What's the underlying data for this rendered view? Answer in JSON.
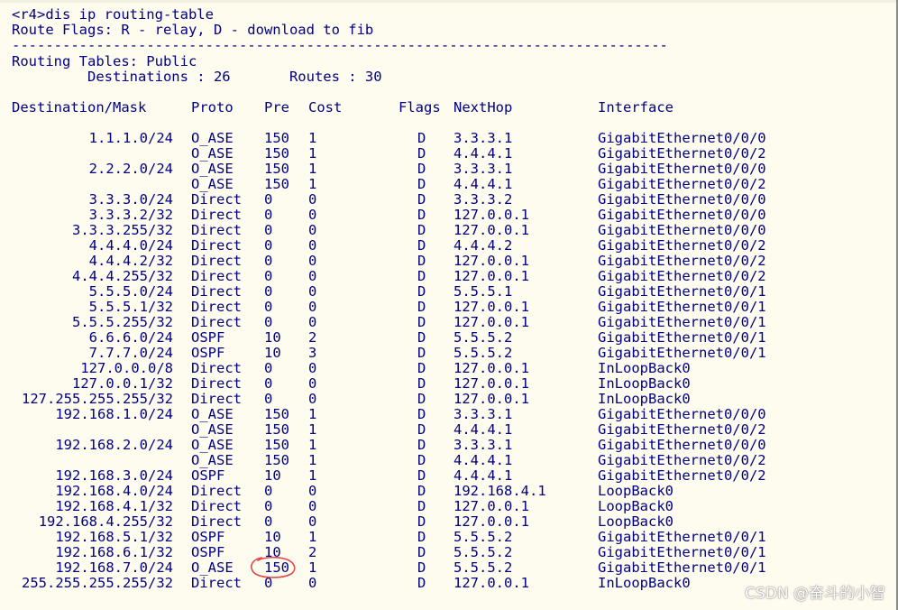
{
  "command_line": "<r4>dis ip routing-table",
  "flags_legend": "Route Flags: R - relay, D - download to fib",
  "separator": "------------------------------------------------------------------------------",
  "table_name": "Routing Tables: Public",
  "summary": "         Destinations : 26       Routes : 30",
  "headers": {
    "destination": "Destination/Mask",
    "proto": "Proto",
    "pre": "Pre",
    "cost": "Cost",
    "flags": "Flags",
    "nexthop": "NextHop",
    "interface": "Interface"
  },
  "routes": [
    {
      "dest": "1.1.1.0/24",
      "proto": "O_ASE",
      "pre": "150",
      "cost": "1",
      "flags": "D",
      "nexthop": "3.3.3.1",
      "iface": "GigabitEthernet0/0/0"
    },
    {
      "dest": "",
      "proto": "O_ASE",
      "pre": "150",
      "cost": "1",
      "flags": "D",
      "nexthop": "4.4.4.1",
      "iface": "GigabitEthernet0/0/2"
    },
    {
      "dest": "2.2.2.0/24",
      "proto": "O_ASE",
      "pre": "150",
      "cost": "1",
      "flags": "D",
      "nexthop": "3.3.3.1",
      "iface": "GigabitEthernet0/0/0"
    },
    {
      "dest": "",
      "proto": "O_ASE",
      "pre": "150",
      "cost": "1",
      "flags": "D",
      "nexthop": "4.4.4.1",
      "iface": "GigabitEthernet0/0/2"
    },
    {
      "dest": "3.3.3.0/24",
      "proto": "Direct",
      "pre": "0",
      "cost": "0",
      "flags": "D",
      "nexthop": "3.3.3.2",
      "iface": "GigabitEthernet0/0/0"
    },
    {
      "dest": "3.3.3.2/32",
      "proto": "Direct",
      "pre": "0",
      "cost": "0",
      "flags": "D",
      "nexthop": "127.0.0.1",
      "iface": "GigabitEthernet0/0/0"
    },
    {
      "dest": "3.3.3.255/32",
      "proto": "Direct",
      "pre": "0",
      "cost": "0",
      "flags": "D",
      "nexthop": "127.0.0.1",
      "iface": "GigabitEthernet0/0/0"
    },
    {
      "dest": "4.4.4.0/24",
      "proto": "Direct",
      "pre": "0",
      "cost": "0",
      "flags": "D",
      "nexthop": "4.4.4.2",
      "iface": "GigabitEthernet0/0/2"
    },
    {
      "dest": "4.4.4.2/32",
      "proto": "Direct",
      "pre": "0",
      "cost": "0",
      "flags": "D",
      "nexthop": "127.0.0.1",
      "iface": "GigabitEthernet0/0/2"
    },
    {
      "dest": "4.4.4.255/32",
      "proto": "Direct",
      "pre": "0",
      "cost": "0",
      "flags": "D",
      "nexthop": "127.0.0.1",
      "iface": "GigabitEthernet0/0/2"
    },
    {
      "dest": "5.5.5.0/24",
      "proto": "Direct",
      "pre": "0",
      "cost": "0",
      "flags": "D",
      "nexthop": "5.5.5.1",
      "iface": "GigabitEthernet0/0/1"
    },
    {
      "dest": "5.5.5.1/32",
      "proto": "Direct",
      "pre": "0",
      "cost": "0",
      "flags": "D",
      "nexthop": "127.0.0.1",
      "iface": "GigabitEthernet0/0/1"
    },
    {
      "dest": "5.5.5.255/32",
      "proto": "Direct",
      "pre": "0",
      "cost": "0",
      "flags": "D",
      "nexthop": "127.0.0.1",
      "iface": "GigabitEthernet0/0/1"
    },
    {
      "dest": "6.6.6.0/24",
      "proto": "OSPF",
      "pre": "10",
      "cost": "2",
      "flags": "D",
      "nexthop": "5.5.5.2",
      "iface": "GigabitEthernet0/0/1"
    },
    {
      "dest": "7.7.7.0/24",
      "proto": "OSPF",
      "pre": "10",
      "cost": "3",
      "flags": "D",
      "nexthop": "5.5.5.2",
      "iface": "GigabitEthernet0/0/1"
    },
    {
      "dest": "127.0.0.0/8",
      "proto": "Direct",
      "pre": "0",
      "cost": "0",
      "flags": "D",
      "nexthop": "127.0.0.1",
      "iface": "InLoopBack0"
    },
    {
      "dest": "127.0.0.1/32",
      "proto": "Direct",
      "pre": "0",
      "cost": "0",
      "flags": "D",
      "nexthop": "127.0.0.1",
      "iface": "InLoopBack0"
    },
    {
      "dest": "127.255.255.255/32",
      "proto": "Direct",
      "pre": "0",
      "cost": "0",
      "flags": "D",
      "nexthop": "127.0.0.1",
      "iface": "InLoopBack0"
    },
    {
      "dest": "192.168.1.0/24",
      "proto": "O_ASE",
      "pre": "150",
      "cost": "1",
      "flags": "D",
      "nexthop": "3.3.3.1",
      "iface": "GigabitEthernet0/0/0"
    },
    {
      "dest": "",
      "proto": "O_ASE",
      "pre": "150",
      "cost": "1",
      "flags": "D",
      "nexthop": "4.4.4.1",
      "iface": "GigabitEthernet0/0/2"
    },
    {
      "dest": "192.168.2.0/24",
      "proto": "O_ASE",
      "pre": "150",
      "cost": "1",
      "flags": "D",
      "nexthop": "3.3.3.1",
      "iface": "GigabitEthernet0/0/0"
    },
    {
      "dest": "",
      "proto": "O_ASE",
      "pre": "150",
      "cost": "1",
      "flags": "D",
      "nexthop": "4.4.4.1",
      "iface": "GigabitEthernet0/0/2"
    },
    {
      "dest": "192.168.3.0/24",
      "proto": "OSPF",
      "pre": "10",
      "cost": "1",
      "flags": "D",
      "nexthop": "4.4.4.1",
      "iface": "GigabitEthernet0/0/2"
    },
    {
      "dest": "192.168.4.0/24",
      "proto": "Direct",
      "pre": "0",
      "cost": "0",
      "flags": "D",
      "nexthop": "192.168.4.1",
      "iface": "LoopBack0"
    },
    {
      "dest": "192.168.4.1/32",
      "proto": "Direct",
      "pre": "0",
      "cost": "0",
      "flags": "D",
      "nexthop": "127.0.0.1",
      "iface": "LoopBack0"
    },
    {
      "dest": "192.168.4.255/32",
      "proto": "Direct",
      "pre": "0",
      "cost": "0",
      "flags": "D",
      "nexthop": "127.0.0.1",
      "iface": "LoopBack0"
    },
    {
      "dest": "192.168.5.1/32",
      "proto": "OSPF",
      "pre": "10",
      "cost": "1",
      "flags": "D",
      "nexthop": "5.5.5.2",
      "iface": "GigabitEthernet0/0/1"
    },
    {
      "dest": "192.168.6.1/32",
      "proto": "OSPF",
      "pre": "10",
      "cost": "2",
      "flags": "D",
      "nexthop": "5.5.5.2",
      "iface": "GigabitEthernet0/0/1"
    },
    {
      "dest": "192.168.7.0/24",
      "proto": "O_ASE",
      "pre": "150",
      "cost": "1",
      "flags": "D",
      "nexthop": "5.5.5.2",
      "iface": "GigabitEthernet0/0/1"
    },
    {
      "dest": "255.255.255.255/32",
      "proto": "Direct",
      "pre": "0",
      "cost": "0",
      "flags": "D",
      "nexthop": "127.0.0.1",
      "iface": "InLoopBack0"
    }
  ],
  "watermark": "CSDN @奋斗的小智",
  "colors": {
    "background": "#fefcef",
    "text": "#000080",
    "annotation": "#e0484a"
  }
}
